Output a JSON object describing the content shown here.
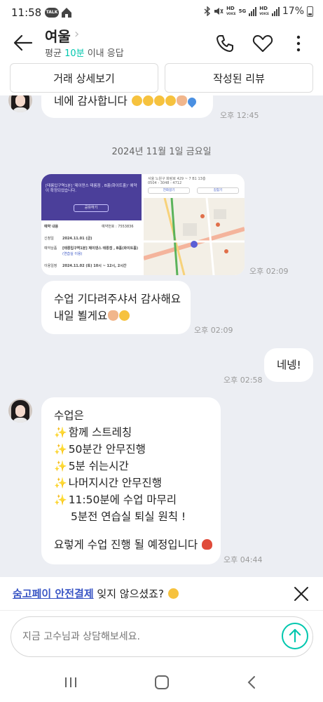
{
  "status_bar": {
    "time": "11:58",
    "talk_badge": "TALK",
    "battery": "17%",
    "hd_label": "HD",
    "voice_label": "VOICE",
    "net_label": "5G"
  },
  "header": {
    "title": "여울",
    "subtitle_prefix": "평균",
    "subtitle_highlight": "10분",
    "subtitle_suffix": "이내 응답",
    "accent_color": "#00c7ae"
  },
  "actions": {
    "deal_detail": "거래 상세보기",
    "written_review": "작성된 리뷰"
  },
  "chat": {
    "msg0": {
      "text": "네에 감사합니다",
      "time": "오후 12:45"
    },
    "date_divider": "2024년 11월 1일 금요일",
    "image_msg": {
      "time": "오후 02:09",
      "banner_text": "[태릉입구역1분] '제이댄스 태릉점 , B홀(화이트홀)' 예약이 확정되었습니다.",
      "banner_button": "공유하기",
      "reservation_label": "예약 내용",
      "reservation_number": "예약번호 : 7553836",
      "row1_label": "신청일",
      "row1_value": "2024.11.01 (금)",
      "row2_label": "예약상품",
      "row2_value": "[태릉입구역1분] 제이댄스 태릉점 , B홀(화이트홀)",
      "row2_sub": "(연습실 이용)",
      "row3_label": "이용일정",
      "row3_value": "2024.11.02 (토) 10시 ~ 12시, 2시간",
      "map_line1": "서울 노원구 화랑로 429 ~ 7 B1 13층",
      "map_line2": "0504 - 3048 - 4712",
      "map_btn1": "전화걸기",
      "map_btn2": "길찾기"
    },
    "msg1": {
      "line1": "수업 기다려주샤서 감사해요",
      "line2": "내일 뵐게요",
      "time": "오후 02:09"
    },
    "msg_mine": {
      "text": "네넹!",
      "time": "오후 02:58"
    },
    "msg2": {
      "intro": "수업은",
      "items": [
        "함께 스트레칭",
        "50분간 안무진행",
        "5분 쉬는시간",
        "나머지시간 안무진행",
        "11:50분에 수업 마무리"
      ],
      "sub_note": "5분전 연습실 퇴실 원칙 !",
      "closing": "요렇게 수업 진행 될 예정입니다",
      "time": "오후 04:44"
    }
  },
  "pay_notice": {
    "link": "숨고페이 안전결제",
    "suffix": "잊지 않으셨죠?"
  },
  "composer": {
    "placeholder": "지금 고수님과 상담해보세요."
  },
  "icons": {
    "back": "back-arrow-icon",
    "phone": "phone-icon",
    "heart": "heart-icon",
    "more": "more-vertical-icon",
    "close": "close-icon",
    "send": "send-arrow-icon"
  }
}
